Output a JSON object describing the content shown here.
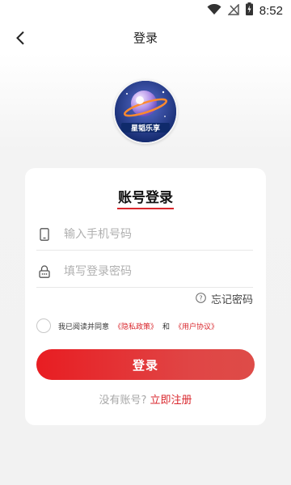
{
  "status_bar": {
    "time": "8:52",
    "icons": [
      "wifi-icon",
      "signal-off-icon",
      "battery-charging-icon"
    ]
  },
  "nav": {
    "back_icon": "chevron-left-icon",
    "title": "登录"
  },
  "logo": {
    "name": "app-logo",
    "text": "星韬乐享"
  },
  "login_card": {
    "title": "账号登录",
    "phone_field": {
      "placeholder": "输入手机号码",
      "value": "",
      "icon": "phone-icon"
    },
    "password_field": {
      "placeholder": "填写登录密码",
      "value": "",
      "icon": "lock-icon"
    },
    "forgot": {
      "icon": "question-circle-icon",
      "label": "忘记密码"
    },
    "agreement": {
      "checked": false,
      "prefix": "我已阅读并同意",
      "privacy_link": "《隐私政策》",
      "and": "和",
      "user_link": "《用户协议》"
    },
    "login_button": "登录",
    "register": {
      "question": "没有账号?",
      "link": "立即注册"
    }
  },
  "colors": {
    "accent": "#d9262c",
    "button_start": "#e81d22",
    "button_end": "#de4c48",
    "background": "#f2f2f2"
  }
}
